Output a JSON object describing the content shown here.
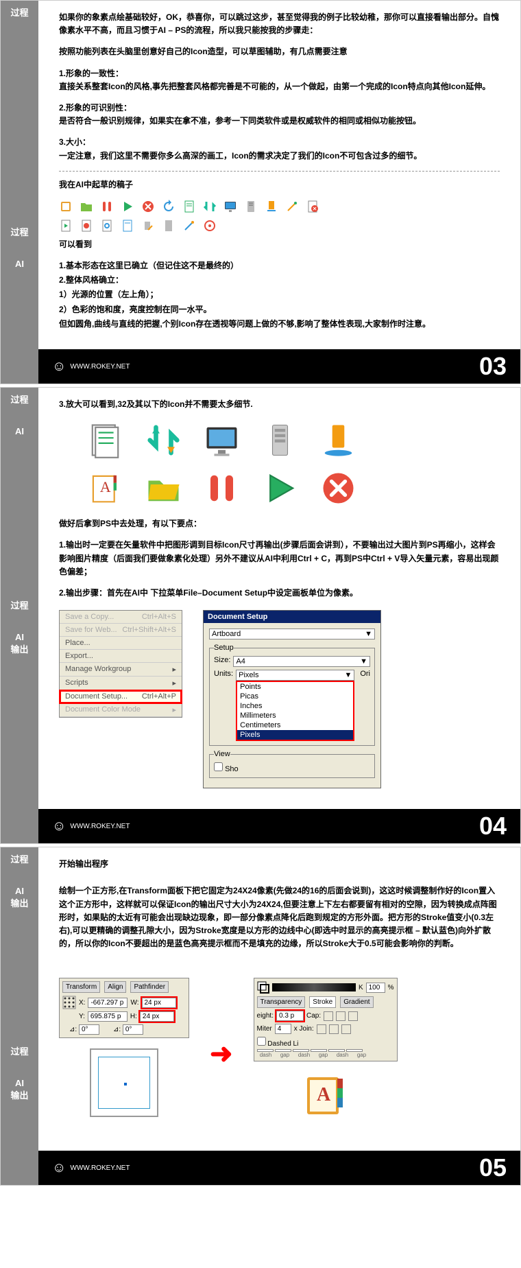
{
  "sidebar": {
    "p3_label": "过程",
    "p3_sub1": "过程",
    "p3_sub2": "AI",
    "p4_label": "过程",
    "p4_sub1": "AI",
    "p4_label2": "过程",
    "p4_sub2": "AI\n输出",
    "p5_label": "过程",
    "p5_sub1": "AI\n输出",
    "p5_label2": "过程",
    "p5_sub2": "AI\n输出"
  },
  "p3": {
    "para1": "如果你的象素点绘基础较好，OK，恭喜你，可以跳过这步，甚至觉得我的例子比较幼稚，那你可以直接看输出部分。自愧像素水平不高，而且习惯于AI – PS的流程，所以我只能按我的步骤走：",
    "para2": "按照功能列表在头脑里创意好自己的Icon造型，可以草图辅助，有几点需要注意",
    "h1": "1.形象的一致性：",
    "para3": "直接关系整套Icon的风格,事先把整套风格都完善是不可能的，从一个做起，由第一个完成的Icon特点向其他Icon延伸。",
    "h2": "2.形象的可识别性：",
    "para4": "是否符合一般识别规律，如果实在拿不准，参考一下同类软件或是权威软件的相同或相似功能按钮。",
    "h3": "3.大小：",
    "para5": "一定注意，我们这里不需要你多么高深的画工，Icon的需求决定了我们的Icon不可包含过多的细节。",
    "draft": "我在AI中起草的稿子",
    "see": "可以看到",
    "s1": "1.基本形态在这里已确立（但记住这不是最终的）",
    "s2": "2.整体风格确立：",
    "s2a": "  1）光源的位置（左上角）；",
    "s2b": "  2）色彩的饱和度，亮度控制在同一水平。",
    "para6": "但如圆角,曲线与直线的把握,个别Icon存在透视等问题上做的不够,影响了整体性表现,大家制作时注意。"
  },
  "p4": {
    "para1": "3.放大可以看到,32及其以下的Icon并不需要太多细节.",
    "para2": "做好后拿到PS中去处理，有以下要点：",
    "para3": "1.输出时一定要在矢量软件中把图形调到目标Icon尺寸再输出(步骤后面会讲到），不要输出过大图片到PS再缩小，这样会影响图片精度（后面我们要做象素化处理）另外不建议从AI中利用Ctrl + C，再到PS中Ctrl + V导入矢量元素，容易出现颜色偏差；",
    "para4": "2.输出步骤：首先在AI中 下拉菜单File–Document Setup中设定画板单位为像素。",
    "menu": {
      "saveCopy": "Save a Copy...",
      "saveCopyKey": "Ctrl+Alt+S",
      "saveWeb": "Save for Web...",
      "saveWebKey": "Ctrl+Shift+Alt+S",
      "place": "Place...",
      "export": "Export...",
      "workgroup": "Manage Workgroup",
      "scripts": "Scripts",
      "docSetup": "Document Setup...",
      "docSetupKey": "Ctrl+Alt+P",
      "colorMode": "Document Color Mode"
    },
    "dialog": {
      "title": "Document Setup",
      "artboard": "Artboard",
      "setup": "Setup",
      "sizeL": "Size:",
      "sizeV": "A4",
      "unitsL": "Units:",
      "unitsV": "Pixels",
      "view": "View",
      "sho": "Sho",
      "ori": "Ori",
      "opts": [
        "Points",
        "Picas",
        "Inches",
        "Millimeters",
        "Centimeters",
        "Pixels"
      ]
    }
  },
  "p5": {
    "h1": "开始输出程序",
    "para1": "绘制一个正方形,在Transform面板下把它固定为24X24像素(先做24的16的后面会说到)，这这时候调整制作好的Icon置入这个正方形中，这样就可以保证Icon的输出尺寸大小为24X24,但要注意上下左右都要留有相对的空隙，因为转换成点阵图形时，如果贴的太近有可能会出现缺边现象，即一部分像素点降化后跑到规定的方形外面。把方形的Stroke值变小(0.3左右),可以更精确的调整孔隙大小，因为Stroke宽度是以方形的边线中心(即选中时显示的高亮提示框 – 默认蓝色)向外扩散的，所以你的Icon不要超出的是蓝色高亮提示框而不是填充的边缘，所以Stroke大于0.5可能会影响你的判断。",
    "transform": {
      "tabs": [
        "Transform",
        "Align",
        "Pathfinder"
      ],
      "x": "-667.297 p",
      "y": "695.875 p",
      "w": "24 px",
      "h": "24 px",
      "wL": "W:",
      "hL": "H:",
      "xL": "X:",
      "yL": "Y:",
      "a0": "0°"
    },
    "stroke": {
      "k": "K",
      "pct": "100",
      "pctSym": "%",
      "tabs": [
        "Transparency",
        "Stroke",
        "Gradient"
      ],
      "weightL": "eight:",
      "weightV": "0.3 p",
      "gapL": "Cap:",
      "miterL": "Miter",
      "miterV": "4",
      "joinL": "x Join:",
      "dashedL": "Dashed Li",
      "dash": "dash",
      "gap": "gap"
    }
  },
  "footer": {
    "site": "WWW.ROKEY.NET",
    "n3": "03",
    "n4": "04",
    "n5": "05"
  }
}
